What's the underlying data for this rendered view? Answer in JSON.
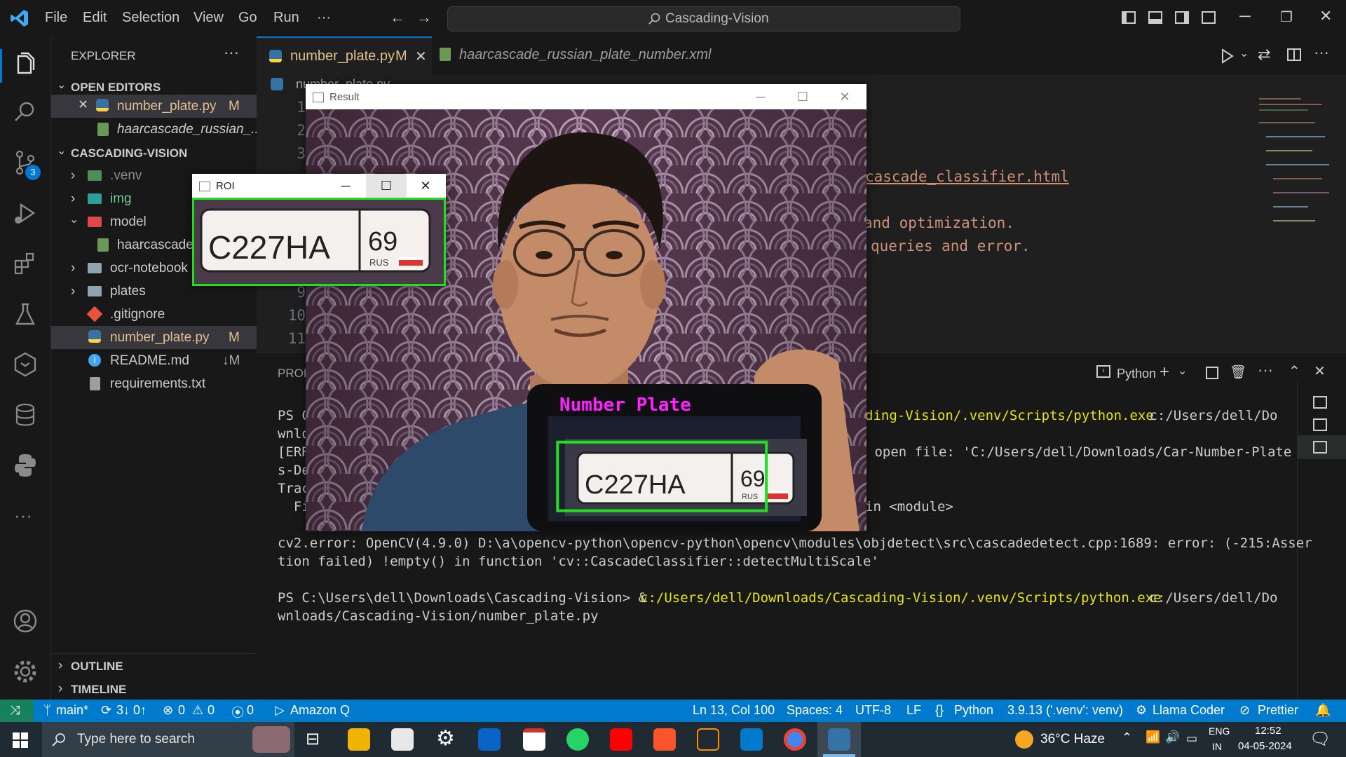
{
  "titlebar": {
    "menu": [
      "File",
      "Edit",
      "Selection",
      "View",
      "Go",
      "Run",
      "···"
    ],
    "search": "Cascading-Vision"
  },
  "explorer": {
    "header": "EXPLORER",
    "open_editors_title": "OPEN EDITORS",
    "open_editors": [
      {
        "name": "number_plate.py",
        "badge": "M"
      },
      {
        "name": "haarcascade_russian_..."
      }
    ],
    "project_title": "CASCADING-VISION",
    "tree": [
      {
        "name": ".venv"
      },
      {
        "name": "img"
      },
      {
        "name": "model"
      },
      {
        "name": "haarcascade"
      },
      {
        "name": "ocr-notebook"
      },
      {
        "name": "plates"
      },
      {
        "name": ".gitignore"
      },
      {
        "name": "number_plate.py",
        "badge": "M"
      },
      {
        "name": "README.md",
        "badge": "↓M"
      },
      {
        "name": "requirements.txt"
      }
    ],
    "outline": "OUTLINE",
    "timeline": "TIMELINE"
  },
  "tabs": [
    {
      "label": "number_plate.py",
      "badge": "M"
    },
    {
      "label": "haarcascade_russian_plate_number.xml"
    }
  ],
  "breadcrumb": "number_plate.py",
  "editor": {
    "line_numbers": [
      "1",
      "2",
      "3",
      "9",
      "10",
      "11"
    ],
    "visible_code": [
      "cascade_classifier.html",
      "and optimization.",
      "queries and error."
    ]
  },
  "panel": {
    "tab_fragment": "PROB",
    "shell_label": "Python",
    "lines": {
      "l1a": "PS C",
      "l1b": "ding-Vision/.venv/Scripts/python.exe",
      "l1c": " c:/Users/dell/Do",
      "l2a": "wnlo",
      "l3a": "[ERR",
      "l3b": " open file: 'C:/Users/dell/Downloads/Car-Number-Plate",
      "l4a": "s-De",
      "l5a": "Trac",
      "l6a": "  Fi",
      "l6b": "in <module>",
      "l7": "cv2.error: OpenCV(4.9.0) D:\\a\\opencv-python\\opencv-python\\opencv\\modules\\objdetect\\src\\cascadedetect.cpp:1689: error: (-215:Asser",
      "l8": "tion failed) !empty() in function 'cv::CascadeClassifier::detectMultiScale'",
      "l9a": "PS C:\\Users\\dell\\Downloads\\Cascading-Vision> & ",
      "l9b": "c:/Users/dell/Downloads/Cascading-Vision/.venv/Scripts/python.exe",
      "l9c": " c:/Users/dell/Do",
      "l10": "wnloads/Cascading-Vision/number_plate.py"
    }
  },
  "result_window": {
    "title": "Result",
    "label": "Number Plate",
    "plate_text": "C227HA",
    "plate_region": "69",
    "plate_country": "RUS"
  },
  "roi_window": {
    "title": "ROI",
    "plate_text": "C227HA",
    "plate_region": "69",
    "plate_country": "RUS"
  },
  "statusbar": {
    "branch": "main*",
    "sync": "3↓ 0↑",
    "errors": "0",
    "warnings": "0",
    "ports": "0",
    "amazon": "Amazon Q",
    "position": "Ln 13, Col 100",
    "spaces": "Spaces: 4",
    "encoding": "UTF-8",
    "eol": "LF",
    "language": "Python",
    "interpreter": "3.9.13 ('.venv': venv)",
    "llama": "Llama Coder",
    "prettier": "Prettier"
  },
  "taskbar": {
    "search_placeholder": "Type here to search",
    "weather": "36°C  Haze",
    "lang_top": "ENG",
    "lang_bottom": "IN",
    "time": "12:52",
    "date": "04-05-2024"
  },
  "activity_badge": "3",
  "colors": {
    "accent": "#007acc",
    "detection_box": "#22dd22",
    "label_magenta": "#ff22ff",
    "terminal_yellow": "#e5e510"
  }
}
